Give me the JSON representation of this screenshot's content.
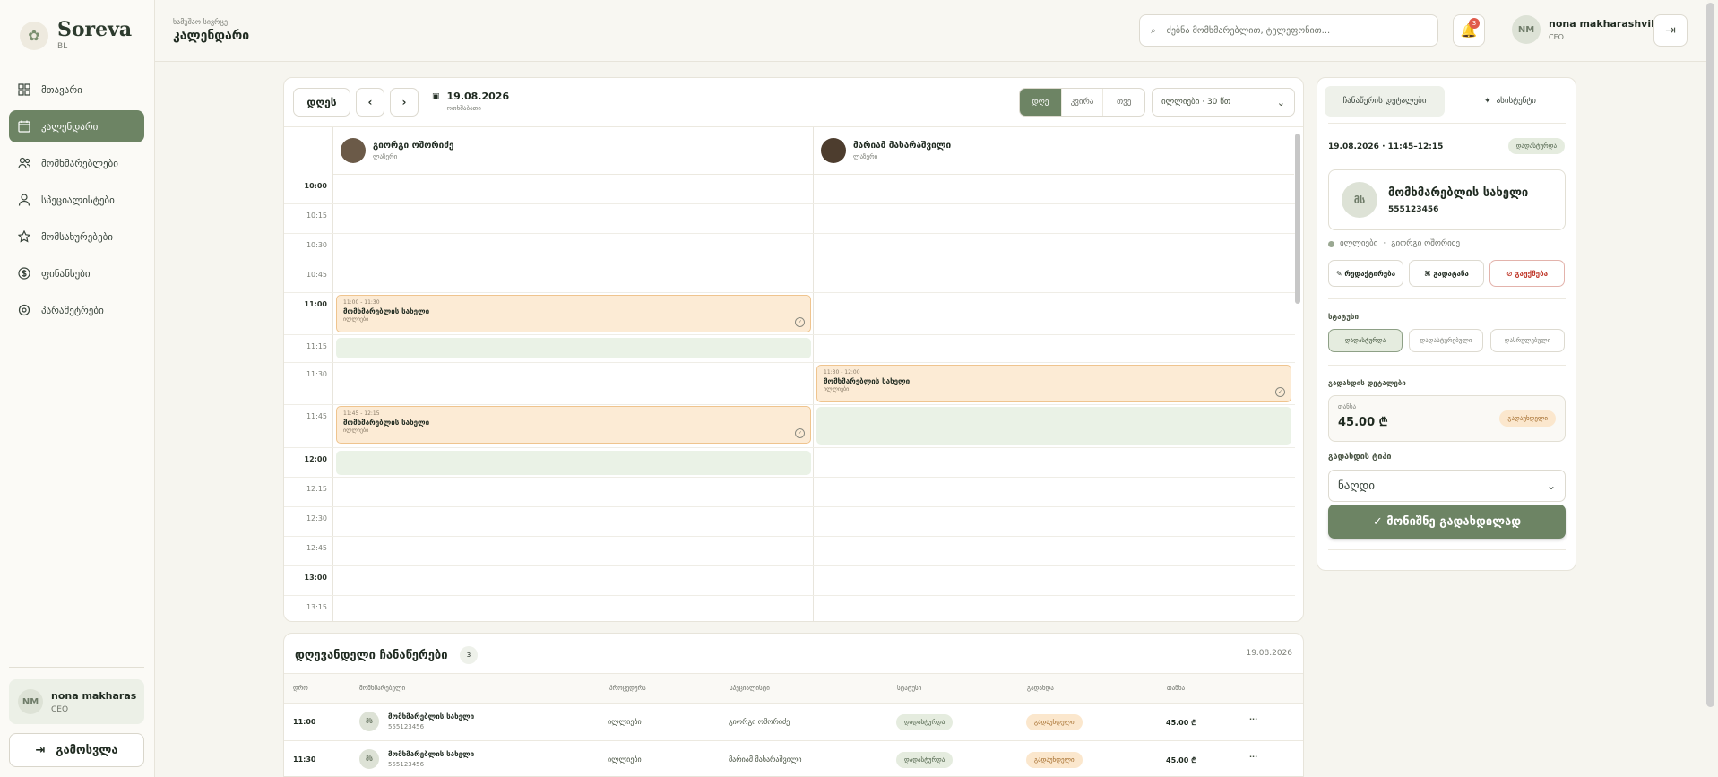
{
  "brand": {
    "name": "Soreva",
    "sub": "BL"
  },
  "sidebar": {
    "items": [
      {
        "label": "მთავარი",
        "icon": "grid-icon"
      },
      {
        "label": "კალენდარი",
        "icon": "calendar-icon",
        "active": true
      },
      {
        "label": "მომხმარებლები",
        "icon": "users-icon"
      },
      {
        "label": "სპეციალისტები",
        "icon": "user-icon"
      },
      {
        "label": "მომსახურებები",
        "icon": "star-icon"
      },
      {
        "label": "ფინანსები",
        "icon": "dollar-icon"
      },
      {
        "label": "პარამეტრები",
        "icon": "settings-icon"
      }
    ],
    "user": {
      "initials": "NM",
      "name": "nona makharas...",
      "role": "CEO"
    },
    "logout_label": "გამოსვლა"
  },
  "header": {
    "crumb": "ხამუშაო სივრცე",
    "title": "კალენდარი",
    "search_placeholder": "ძებნა მომხმარებლით, ტელეფონით...",
    "notifications": "3",
    "user": {
      "initials": "NM",
      "name": "nona makharashvili",
      "role": "CEO"
    }
  },
  "calendar": {
    "today_label": "დღეს",
    "prev": "‹",
    "next": "›",
    "date": "19.08.2026",
    "weekday": "ოთხშაბათი",
    "views": [
      "დღე",
      "კვირა",
      "თვე"
    ],
    "service_select": "ილლიები · 30 წთ",
    "specialists": [
      {
        "name": "გიორგი ოშორიძე",
        "sub": "ლაზერი"
      },
      {
        "name": "მარიამ მახარაშვილი",
        "sub": "ლაზერი"
      }
    ],
    "times": [
      "10:00",
      "10:15",
      "10:30",
      "10:45",
      "11:00",
      "11:15",
      "11:30",
      "11:45",
      "12:00",
      "12:15",
      "12:30",
      "12:45",
      "13:00",
      "13:15"
    ],
    "appointments": [
      {
        "time": "11:00 - 11:30",
        "name": "მომხმარებლის სახელი",
        "service": "ილლიები"
      },
      {
        "time": "11:30 - 12:00",
        "name": "მომხმარებლის სახელი",
        "service": "ილლიები"
      },
      {
        "time": "11:45 - 12:15",
        "name": "მომხმარებლის სახელი",
        "service": "ილლიები"
      }
    ]
  },
  "today": {
    "title": "დღევანდელი ჩანაწერები",
    "count": "3",
    "date": "19.08.2026",
    "columns": [
      "დრო",
      "მომხმარებელი",
      "პროცედურა",
      "სპეციალისტი",
      "სტატუსი",
      "გადახდა",
      "თანხა"
    ],
    "rows": [
      {
        "time": "11:00",
        "initials": "მს",
        "name": "მომხმარებლის სახელი",
        "phone": "555123456",
        "procedure": "ილლიები",
        "specialist": "გიორგი ოშორიძე",
        "status": "დადასტურდა",
        "payment": "გადაუხდელი",
        "amount": "45.00 ₾"
      },
      {
        "time": "11:30",
        "initials": "მს",
        "name": "მომხმარებლის სახელი",
        "phone": "555123456",
        "procedure": "ილლიები",
        "specialist": "მარიამ მახარაშვილი",
        "status": "დადასტურდა",
        "payment": "გადაუხდელი",
        "amount": "45.00 ₾"
      }
    ],
    "more": "···"
  },
  "panel": {
    "tabs": [
      "ჩანაწერის დეტალები",
      "ასისტენტი"
    ],
    "datetime": "19.08.2026 · 11:45–12:15",
    "status_badge": "დადასტურდა",
    "client": {
      "initials": "მს",
      "name": "მომხმარებლის სახელი",
      "phone": "555123456"
    },
    "meta_service": "ილლიები",
    "meta_sep": "·",
    "meta_specialist": "გიორგი ოშორიძე",
    "actions": [
      "✎ რედაქტირება",
      "⌘ გადატანა",
      "⊘ გაუქმება"
    ],
    "status_label": "სტატუსი",
    "statuses": [
      "დადასტურდა",
      "დადასტურებული",
      "დასრულებული"
    ],
    "payment_details_label": "გადახდის დეტალები",
    "amount_label": "თანხა",
    "amount": "45.00 ₾",
    "payment_badge": "გადაუხდელი",
    "payment_type_label": "გადახდის ტიპი",
    "payment_type": "ნაღდი",
    "mark_paid": "✓ მონიშნე გადახდილად"
  }
}
